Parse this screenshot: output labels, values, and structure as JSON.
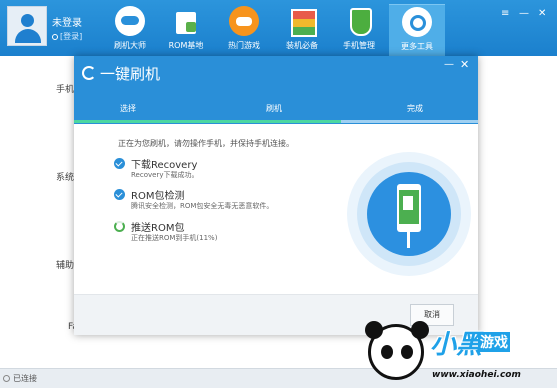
{
  "header": {
    "user_name": "未登录",
    "login_link": "[登录]",
    "nav": [
      {
        "label": "刷机大师",
        "icon": "cloud-icon"
      },
      {
        "label": "ROM基地",
        "icon": "shopping-bag-icon"
      },
      {
        "label": "热门游戏",
        "icon": "gamepad-icon"
      },
      {
        "label": "装机必备",
        "icon": "apps-grid-icon"
      },
      {
        "label": "手机管理",
        "icon": "shield-icon"
      },
      {
        "label": "更多工具",
        "icon": "tools-icon"
      }
    ],
    "active_nav": "更多工具"
  },
  "background": {
    "sections": [
      "手机",
      "系统",
      "辅助"
    ],
    "partial_label": "Fa",
    "status": "已连接"
  },
  "dialog": {
    "title": "一键刷机",
    "steps": [
      "选择",
      "刷机",
      "完成"
    ],
    "step_progress": 0.66,
    "intro": "正在为您刷机，请勿操作手机，并保持手机连接。",
    "tasks": [
      {
        "name": "下载Recovery",
        "desc": "Recovery下载成功。",
        "state": "done"
      },
      {
        "name": "ROM包检测",
        "desc": "腾讯安全检测，ROM包安全无毒无恶意软件。",
        "state": "done"
      },
      {
        "name": "推送ROM包",
        "desc": "正在推送ROM到手机(11%)",
        "state": "in-progress"
      }
    ],
    "cancel_label": "取消"
  },
  "watermark": {
    "brand": "小黑",
    "brand_sub": "游戏",
    "url": "www.xiaohei.com"
  },
  "colors": {
    "header_blue": "#1b80cd",
    "dialog_blue": "#2a8fd8",
    "progress_green": "#4cd7a1",
    "task_check": "#2a8fd8"
  }
}
